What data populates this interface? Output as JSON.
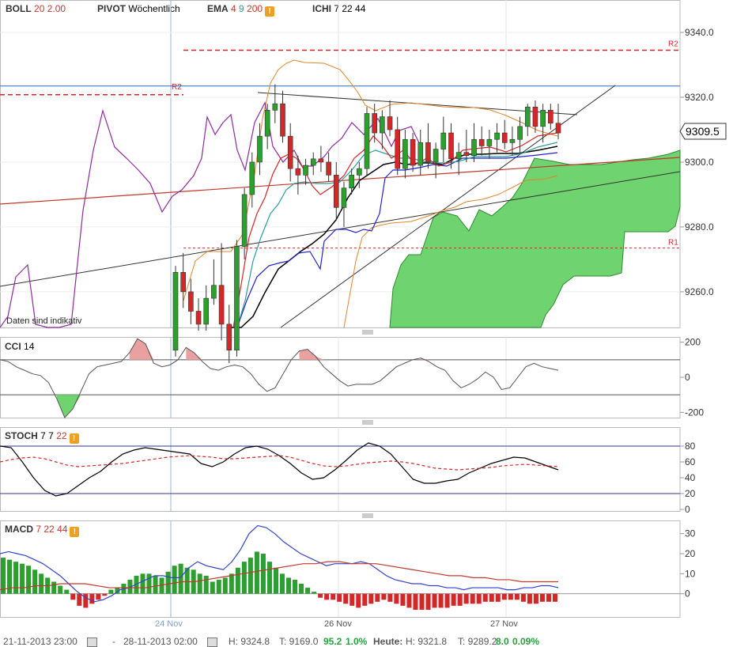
{
  "indicators": {
    "boll": {
      "name": "BOLL",
      "params": "20",
      "params2": "2.00"
    },
    "pivot": {
      "name": "PIVOT",
      "params": "Wöchentlich"
    },
    "ema": {
      "name": "EMA",
      "p1": "4",
      "p2": "9",
      "p3": "200",
      "warning": "!"
    },
    "ichi": {
      "name": "ICHI",
      "params": "7 22 44"
    }
  },
  "main_chart": {
    "last_price": "9309.5",
    "y_ticks": [
      "9340.0",
      "9320.0",
      "9300.0",
      "9280.0",
      "9260.0"
    ],
    "r2_label": "R2",
    "r1_label": "R1",
    "r2_left_label": "R2",
    "note": "Daten sind indikativ"
  },
  "cci": {
    "name": "CCI",
    "params": "14",
    "y_ticks": [
      "200",
      "0",
      "-200"
    ]
  },
  "stoch": {
    "name": "STOCH",
    "p1": "7",
    "p2": "7",
    "p3": "22",
    "warning": "!",
    "y_ticks": [
      "80",
      "60",
      "40",
      "20",
      "0"
    ]
  },
  "macd": {
    "name": "MACD",
    "p1": "7",
    "p2": "22",
    "p3": "44",
    "warning": "!",
    "y_ticks": [
      "30",
      "20",
      "10",
      "0"
    ]
  },
  "x_axis": {
    "labels": [
      "24 Nov",
      "26 Nov",
      "27 Nov"
    ]
  },
  "status": {
    "from": "21-11-2013 23:00",
    "dash": "-",
    "to": "28-11-2013 02:00",
    "high": "H: 9324.8",
    "low": "T: 9169.0",
    "change": "95.2",
    "change_pct": "1.0%",
    "today_label": "Heute:",
    "today_high": "H: 9321.8",
    "today_low": "T: 9289.2",
    "today_change": "8.0",
    "today_change_pct": "0.09%"
  },
  "colors": {
    "up": "#2ca02c",
    "down": "#d62728",
    "cloud": "#6fd36f",
    "boll": "#e0862a",
    "ema4": "#d62728",
    "ema9": "#2a9d9d",
    "ema200": "#c0392b",
    "cci": "#555555",
    "macd": "#3344cc",
    "signal": "#c0392b",
    "kijun": "#000000",
    "tenkan": "#2222cc",
    "chikou": "#8e2c9e"
  },
  "chart_data": [
    {
      "type": "candlestick",
      "title": "",
      "ylim": [
        9249,
        9350
      ],
      "y_ticks": [
        9340,
        9320,
        9300,
        9280,
        9260
      ],
      "last": 9309.5,
      "pivot_levels": {
        "R2": 9334.5,
        "R1": 9273.5,
        "R2_prev": 9322
      },
      "ohlc": [
        [
          9242,
          9268,
          9240,
          9266
        ],
        [
          9266,
          9272,
          9255,
          9260
        ],
        [
          9260,
          9264,
          9250,
          9254
        ],
        [
          9254,
          9258,
          9248,
          9250
        ],
        [
          9250,
          9262,
          9248,
          9258
        ],
        [
          9258,
          9270,
          9256,
          9262
        ],
        [
          9262,
          9275,
          9245,
          9250
        ],
        [
          9250,
          9256,
          9238,
          9242
        ],
        [
          9242,
          9276,
          9240,
          9274
        ],
        [
          9274,
          9292,
          9270,
          9290
        ],
        [
          9290,
          9303,
          9286,
          9300
        ],
        [
          9300,
          9312,
          9296,
          9308
        ],
        [
          9308,
          9318,
          9304,
          9316
        ],
        [
          9316,
          9324,
          9312,
          9318
        ],
        [
          9318,
          9322,
          9306,
          9308
        ],
        [
          9308,
          9312,
          9294,
          9298
        ],
        [
          9298,
          9302,
          9290,
          9296
        ],
        [
          9296,
          9301,
          9293,
          9299
        ],
        [
          9299,
          9303,
          9296,
          9301
        ],
        [
          9301,
          9305,
          9297,
          9300
        ],
        [
          9300,
          9303,
          9294,
          9296
        ],
        [
          9296,
          9300,
          9282,
          9286
        ],
        [
          9286,
          9294,
          9280,
          9292
        ],
        [
          9292,
          9298,
          9290,
          9296
        ],
        [
          9296,
          9300,
          9292,
          9298
        ],
        [
          9298,
          9317,
          9296,
          9315
        ],
        [
          9315,
          9318,
          9306,
          9309
        ],
        [
          9309,
          9316,
          9304,
          9314
        ],
        [
          9314,
          9319,
          9308,
          9310
        ],
        [
          9310,
          9314,
          9296,
          9298
        ],
        [
          9298,
          9310,
          9295,
          9307
        ],
        [
          9307,
          9309,
          9297,
          9299
        ],
        [
          9299,
          9310,
          9296,
          9306
        ],
        [
          9306,
          9312,
          9298,
          9300
        ],
        [
          9300,
          9306,
          9295,
          9304
        ],
        [
          9304,
          9314,
          9300,
          9309
        ],
        [
          9309,
          9312,
          9298,
          9301
        ],
        [
          9301,
          9306,
          9296,
          9303
        ],
        [
          9303,
          9310,
          9300,
          9302
        ],
        [
          9302,
          9312,
          9300,
          9307
        ],
        [
          9307,
          9311,
          9302,
          9305
        ],
        [
          9305,
          9310,
          9301,
          9307
        ],
        [
          9307,
          9312,
          9303,
          9309
        ],
        [
          9309,
          9313,
          9304,
          9306
        ],
        [
          9306,
          9311,
          9302,
          9307
        ],
        [
          9307,
          9314,
          9303,
          9311
        ],
        [
          9311,
          9318,
          9308,
          9317
        ],
        [
          9317,
          9319,
          9309,
          9311
        ],
        [
          9311,
          9318,
          9306,
          9316
        ],
        [
          9316,
          9318,
          9310,
          9312
        ],
        [
          9312,
          9318,
          9307,
          9309
        ]
      ]
    },
    {
      "type": "line",
      "title": "CCI",
      "ylim": [
        -230,
        230
      ],
      "levels": [
        100,
        -100
      ],
      "values": [
        100,
        90,
        60,
        40,
        20,
        10,
        -30,
        -120,
        -230,
        -180,
        -80,
        20,
        60,
        70,
        80,
        90,
        140,
        220,
        190,
        80,
        60,
        70,
        100,
        170,
        140,
        90,
        50,
        40,
        60,
        70,
        60,
        20,
        -40,
        -80,
        -60,
        20,
        100,
        150,
        160,
        120,
        60,
        20,
        -20,
        -50,
        -40,
        -40,
        -40,
        -20,
        20,
        60,
        80,
        100,
        110,
        90,
        60,
        40,
        -20,
        -60,
        -40,
        -10,
        30,
        0,
        -70,
        -60,
        0,
        60,
        80,
        60,
        50,
        40
      ]
    },
    {
      "type": "line",
      "title": "STOCH",
      "ylim": [
        0,
        100
      ],
      "levels": [
        80,
        20
      ],
      "series": [
        {
          "name": "%K",
          "values": [
            80,
            78,
            60,
            40,
            24,
            17,
            20,
            30,
            40,
            48,
            60,
            70,
            75,
            78,
            76,
            74,
            72,
            70,
            58,
            54,
            60,
            70,
            78,
            80,
            76,
            68,
            58,
            46,
            38,
            40,
            50,
            62,
            75,
            84,
            80,
            70,
            54,
            38,
            33,
            33,
            36,
            38,
            46,
            52,
            58,
            62,
            66,
            65,
            60,
            55,
            50
          ]
        },
        {
          "name": "%D",
          "values": [
            60,
            63,
            65,
            66,
            64,
            60,
            56,
            54,
            55,
            56,
            57,
            58,
            60,
            62,
            64,
            66,
            67,
            68,
            67,
            66,
            64,
            64,
            65,
            66,
            67,
            68,
            66,
            62,
            58,
            55,
            54,
            55,
            57,
            59,
            60,
            61,
            60,
            58,
            55,
            52,
            51,
            50,
            51,
            52,
            53,
            55,
            56,
            57,
            56,
            55,
            54
          ]
        }
      ]
    },
    {
      "type": "bar",
      "title": "MACD",
      "ylim": [
        -10,
        35
      ],
      "histogram": [
        18,
        17,
        16,
        15,
        14,
        12,
        10,
        8,
        6,
        4,
        2,
        -3,
        -6,
        -7,
        -5,
        -3,
        -1,
        2,
        3,
        5,
        7,
        9,
        10,
        10,
        9,
        8,
        11,
        14,
        15,
        13,
        12,
        10,
        9,
        6,
        7,
        8,
        10,
        13,
        16,
        18,
        21,
        20,
        16,
        13,
        10,
        8,
        7,
        5,
        3,
        1,
        -2,
        -3,
        -3,
        -4,
        -5,
        -6,
        -7,
        -6,
        -5,
        -4,
        -3,
        -4,
        -5,
        -6,
        -7,
        -8,
        -8,
        -8,
        -7,
        -7,
        -7,
        -6,
        -6,
        -5,
        -5,
        -5,
        -4,
        -4,
        -4,
        -3,
        -3,
        -3,
        -4,
        -5,
        -5,
        -4,
        -4,
        -4
      ],
      "series": [
        {
          "name": "MACD",
          "values": [
            20,
            21,
            20,
            19,
            17,
            15,
            12,
            9,
            5,
            1,
            -2,
            -4,
            -3,
            -1,
            2,
            3,
            5,
            7,
            9,
            9,
            8,
            8,
            13,
            16,
            14,
            13,
            12,
            16,
            22,
            30,
            34,
            33,
            30,
            26,
            23,
            20,
            18,
            16,
            14,
            15,
            15,
            15,
            16,
            15,
            12,
            9,
            7,
            6,
            5,
            5,
            4,
            4,
            3,
            3,
            2,
            3,
            3,
            3,
            3,
            2,
            2,
            3,
            3,
            4,
            4,
            3
          ]
        },
        {
          "name": "Signal",
          "values": [
            2,
            3,
            3,
            4,
            4,
            5,
            5,
            5,
            4,
            3,
            3,
            3,
            3,
            4,
            5,
            6,
            6,
            7,
            8,
            9,
            10,
            11,
            12,
            13,
            14,
            15,
            15,
            16,
            16,
            15,
            15,
            15,
            14,
            13,
            12,
            11,
            10,
            9,
            9,
            8,
            8,
            7,
            7,
            6,
            6,
            6,
            6
          ]
        }
      ]
    }
  ]
}
